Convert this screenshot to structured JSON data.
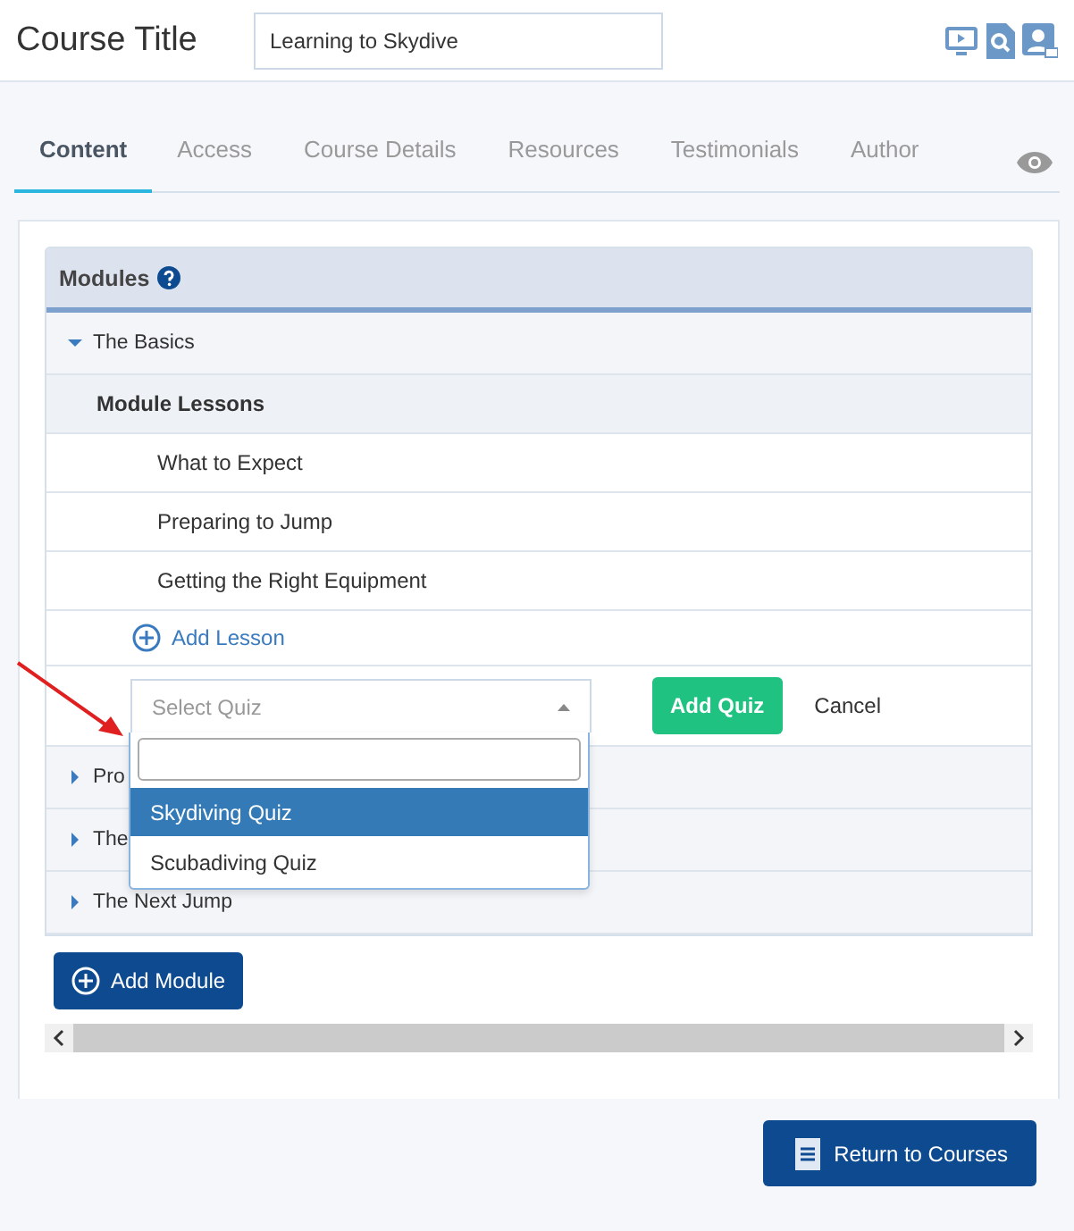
{
  "header": {
    "title": "Course Title",
    "course_name": "Learning to Skydive"
  },
  "tabs": [
    {
      "label": "Content",
      "selected": true
    },
    {
      "label": "Access",
      "selected": false
    },
    {
      "label": "Course Details",
      "selected": false
    },
    {
      "label": "Resources",
      "selected": false
    },
    {
      "label": "Testimonials",
      "selected": false
    },
    {
      "label": "Author",
      "selected": false
    }
  ],
  "modules_panel": {
    "title": "Modules",
    "modules": [
      {
        "name": "The Basics",
        "expanded": true,
        "lessons_heading": "Module Lessons",
        "lessons": [
          "What to Expect",
          "Preparing to Jump",
          "Getting the Right Equipment"
        ],
        "add_lesson": "Add Lesson"
      },
      {
        "name": "Pro",
        "expanded": false
      },
      {
        "name": "The",
        "expanded": false
      },
      {
        "name": "The Next Jump",
        "expanded": false
      }
    ],
    "quiz": {
      "placeholder": "Select Quiz",
      "add_button": "Add Quiz",
      "cancel": "Cancel",
      "options": [
        {
          "label": "Skydiving Quiz",
          "selected": true
        },
        {
          "label": "Scubadiving Quiz",
          "selected": false
        }
      ]
    },
    "add_module": "Add Module"
  },
  "return_button": "Return to Courses"
}
